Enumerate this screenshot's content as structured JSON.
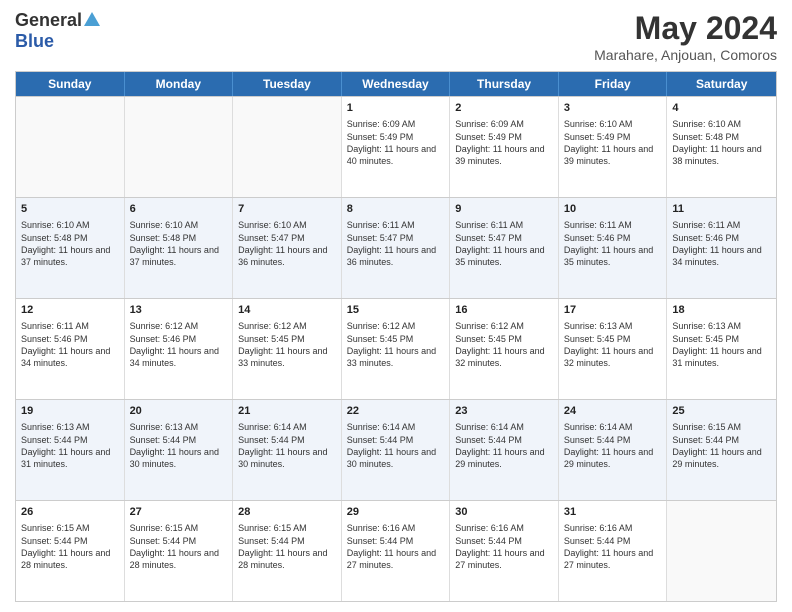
{
  "logo": {
    "general": "General",
    "blue": "Blue"
  },
  "header": {
    "title": "May 2024",
    "subtitle": "Marahare, Anjouan, Comoros"
  },
  "weekdays": [
    "Sunday",
    "Monday",
    "Tuesday",
    "Wednesday",
    "Thursday",
    "Friday",
    "Saturday"
  ],
  "rows": [
    {
      "alt": false,
      "cells": [
        {
          "day": "",
          "sunrise": "",
          "sunset": "",
          "daylight": ""
        },
        {
          "day": "",
          "sunrise": "",
          "sunset": "",
          "daylight": ""
        },
        {
          "day": "",
          "sunrise": "",
          "sunset": "",
          "daylight": ""
        },
        {
          "day": "1",
          "sunrise": "Sunrise: 6:09 AM",
          "sunset": "Sunset: 5:49 PM",
          "daylight": "Daylight: 11 hours and 40 minutes."
        },
        {
          "day": "2",
          "sunrise": "Sunrise: 6:09 AM",
          "sunset": "Sunset: 5:49 PM",
          "daylight": "Daylight: 11 hours and 39 minutes."
        },
        {
          "day": "3",
          "sunrise": "Sunrise: 6:10 AM",
          "sunset": "Sunset: 5:49 PM",
          "daylight": "Daylight: 11 hours and 39 minutes."
        },
        {
          "day": "4",
          "sunrise": "Sunrise: 6:10 AM",
          "sunset": "Sunset: 5:48 PM",
          "daylight": "Daylight: 11 hours and 38 minutes."
        }
      ]
    },
    {
      "alt": true,
      "cells": [
        {
          "day": "5",
          "sunrise": "Sunrise: 6:10 AM",
          "sunset": "Sunset: 5:48 PM",
          "daylight": "Daylight: 11 hours and 37 minutes."
        },
        {
          "day": "6",
          "sunrise": "Sunrise: 6:10 AM",
          "sunset": "Sunset: 5:48 PM",
          "daylight": "Daylight: 11 hours and 37 minutes."
        },
        {
          "day": "7",
          "sunrise": "Sunrise: 6:10 AM",
          "sunset": "Sunset: 5:47 PM",
          "daylight": "Daylight: 11 hours and 36 minutes."
        },
        {
          "day": "8",
          "sunrise": "Sunrise: 6:11 AM",
          "sunset": "Sunset: 5:47 PM",
          "daylight": "Daylight: 11 hours and 36 minutes."
        },
        {
          "day": "9",
          "sunrise": "Sunrise: 6:11 AM",
          "sunset": "Sunset: 5:47 PM",
          "daylight": "Daylight: 11 hours and 35 minutes."
        },
        {
          "day": "10",
          "sunrise": "Sunrise: 6:11 AM",
          "sunset": "Sunset: 5:46 PM",
          "daylight": "Daylight: 11 hours and 35 minutes."
        },
        {
          "day": "11",
          "sunrise": "Sunrise: 6:11 AM",
          "sunset": "Sunset: 5:46 PM",
          "daylight": "Daylight: 11 hours and 34 minutes."
        }
      ]
    },
    {
      "alt": false,
      "cells": [
        {
          "day": "12",
          "sunrise": "Sunrise: 6:11 AM",
          "sunset": "Sunset: 5:46 PM",
          "daylight": "Daylight: 11 hours and 34 minutes."
        },
        {
          "day": "13",
          "sunrise": "Sunrise: 6:12 AM",
          "sunset": "Sunset: 5:46 PM",
          "daylight": "Daylight: 11 hours and 34 minutes."
        },
        {
          "day": "14",
          "sunrise": "Sunrise: 6:12 AM",
          "sunset": "Sunset: 5:45 PM",
          "daylight": "Daylight: 11 hours and 33 minutes."
        },
        {
          "day": "15",
          "sunrise": "Sunrise: 6:12 AM",
          "sunset": "Sunset: 5:45 PM",
          "daylight": "Daylight: 11 hours and 33 minutes."
        },
        {
          "day": "16",
          "sunrise": "Sunrise: 6:12 AM",
          "sunset": "Sunset: 5:45 PM",
          "daylight": "Daylight: 11 hours and 32 minutes."
        },
        {
          "day": "17",
          "sunrise": "Sunrise: 6:13 AM",
          "sunset": "Sunset: 5:45 PM",
          "daylight": "Daylight: 11 hours and 32 minutes."
        },
        {
          "day": "18",
          "sunrise": "Sunrise: 6:13 AM",
          "sunset": "Sunset: 5:45 PM",
          "daylight": "Daylight: 11 hours and 31 minutes."
        }
      ]
    },
    {
      "alt": true,
      "cells": [
        {
          "day": "19",
          "sunrise": "Sunrise: 6:13 AM",
          "sunset": "Sunset: 5:44 PM",
          "daylight": "Daylight: 11 hours and 31 minutes."
        },
        {
          "day": "20",
          "sunrise": "Sunrise: 6:13 AM",
          "sunset": "Sunset: 5:44 PM",
          "daylight": "Daylight: 11 hours and 30 minutes."
        },
        {
          "day": "21",
          "sunrise": "Sunrise: 6:14 AM",
          "sunset": "Sunset: 5:44 PM",
          "daylight": "Daylight: 11 hours and 30 minutes."
        },
        {
          "day": "22",
          "sunrise": "Sunrise: 6:14 AM",
          "sunset": "Sunset: 5:44 PM",
          "daylight": "Daylight: 11 hours and 30 minutes."
        },
        {
          "day": "23",
          "sunrise": "Sunrise: 6:14 AM",
          "sunset": "Sunset: 5:44 PM",
          "daylight": "Daylight: 11 hours and 29 minutes."
        },
        {
          "day": "24",
          "sunrise": "Sunrise: 6:14 AM",
          "sunset": "Sunset: 5:44 PM",
          "daylight": "Daylight: 11 hours and 29 minutes."
        },
        {
          "day": "25",
          "sunrise": "Sunrise: 6:15 AM",
          "sunset": "Sunset: 5:44 PM",
          "daylight": "Daylight: 11 hours and 29 minutes."
        }
      ]
    },
    {
      "alt": false,
      "cells": [
        {
          "day": "26",
          "sunrise": "Sunrise: 6:15 AM",
          "sunset": "Sunset: 5:44 PM",
          "daylight": "Daylight: 11 hours and 28 minutes."
        },
        {
          "day": "27",
          "sunrise": "Sunrise: 6:15 AM",
          "sunset": "Sunset: 5:44 PM",
          "daylight": "Daylight: 11 hours and 28 minutes."
        },
        {
          "day": "28",
          "sunrise": "Sunrise: 6:15 AM",
          "sunset": "Sunset: 5:44 PM",
          "daylight": "Daylight: 11 hours and 28 minutes."
        },
        {
          "day": "29",
          "sunrise": "Sunrise: 6:16 AM",
          "sunset": "Sunset: 5:44 PM",
          "daylight": "Daylight: 11 hours and 27 minutes."
        },
        {
          "day": "30",
          "sunrise": "Sunrise: 6:16 AM",
          "sunset": "Sunset: 5:44 PM",
          "daylight": "Daylight: 11 hours and 27 minutes."
        },
        {
          "day": "31",
          "sunrise": "Sunrise: 6:16 AM",
          "sunset": "Sunset: 5:44 PM",
          "daylight": "Daylight: 11 hours and 27 minutes."
        },
        {
          "day": "",
          "sunrise": "",
          "sunset": "",
          "daylight": ""
        }
      ]
    }
  ]
}
